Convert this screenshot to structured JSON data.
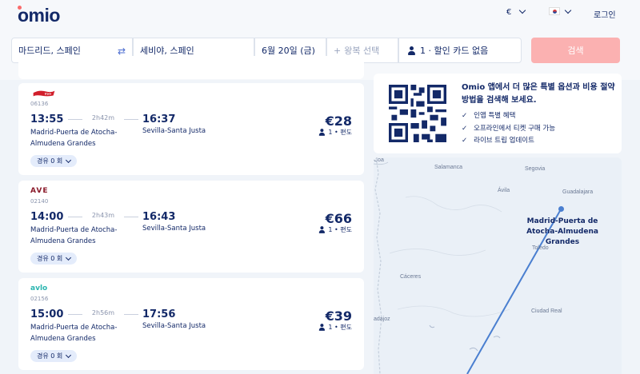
{
  "header": {
    "logo": "omio",
    "currency": "€",
    "login": "로그인"
  },
  "search": {
    "from": "마드리드, 스페인",
    "to": "세비야, 스페인",
    "date": "6월 20일 (금)",
    "return_placeholder": "왕복 선택",
    "passengers": "1 · 할인 카드 없음",
    "button": "검색"
  },
  "results": [
    {
      "operator": "iryo",
      "code": "06136",
      "dep_time": "13:55",
      "duration": "2h42m",
      "arr_time": "16:37",
      "dep_station": "Madrid-Puerta de Atocha-Almudena Grandes",
      "arr_station": "Sevilla-Santa Justa",
      "price": "€28",
      "pax": "1 • 편도",
      "stops": "경유 0 회"
    },
    {
      "operator": "AVE",
      "code": "02140",
      "dep_time": "14:00",
      "duration": "2h43m",
      "arr_time": "16:43",
      "dep_station": "Madrid-Puerta de Atocha-Almudena Grandes",
      "arr_station": "Sevilla-Santa Justa",
      "price": "€66",
      "pax": "1 • 편도",
      "stops": "경유 0 회"
    },
    {
      "operator": "avlo",
      "code": "02156",
      "dep_time": "15:00",
      "duration": "2h56m",
      "arr_time": "17:56",
      "dep_station": "Madrid-Puerta de Atocha-Almudena Grandes",
      "arr_station": "Sevilla-Santa Justa",
      "price": "€39",
      "pax": "1 • 편도",
      "stops": "경유 0 회"
    }
  ],
  "promo": {
    "title": "Omio 앱에서 더 많은 특별 옵션과 비용 절약 방법을 검색해 보세요.",
    "items": [
      "인앱 특별 혜택",
      "오프라인에서 티켓 구매 가능",
      "라이브 트립 업데이트"
    ]
  },
  "map": {
    "cities": {
      "coa": "Coa",
      "salamanca": "Salamanca",
      "segovia": "Segovia",
      "avila": "Ávila",
      "guadalajara": "Guadalajara",
      "toledo": "Toledo",
      "caceres": "Cáceres",
      "ciudad_real": "Ciudad Real",
      "badajoz": "adajoz"
    },
    "destination": "Madrid-Puerta de Atocha-Almudena Grandes"
  },
  "colors": {
    "brand": "#132968",
    "accent": "#fa6b6b",
    "search_button": "#fbb1b1",
    "route": "#4a7fd0"
  }
}
